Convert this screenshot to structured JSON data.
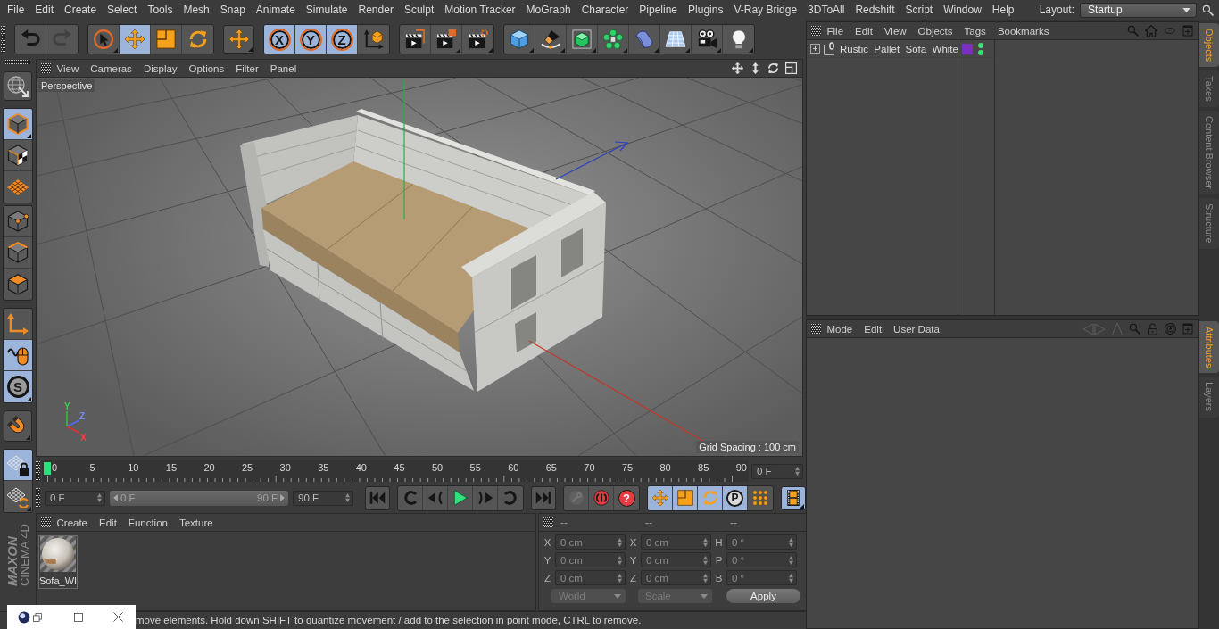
{
  "menu_bar": {
    "items": [
      "File",
      "Edit",
      "Create",
      "Select",
      "Tools",
      "Mesh",
      "Snap",
      "Animate",
      "Simulate",
      "Render",
      "Sculpt",
      "Motion Tracker",
      "MoGraph",
      "Character",
      "Pipeline",
      "Plugins",
      "V-Ray Bridge",
      "3DToAll",
      "Redshift",
      "Script",
      "Window",
      "Help"
    ],
    "layout_label": "Layout:",
    "layout_value": "Startup"
  },
  "toolbar": {
    "groups": [
      {
        "buttons": [
          {
            "on": false,
            "disabled": false
          },
          {
            "on": false,
            "disabled": true
          }
        ]
      },
      {
        "buttons": [
          {
            "on": false,
            "disabled": false
          },
          {
            "on": true,
            "disabled": false
          },
          {
            "on": false,
            "disabled": false
          },
          {
            "on": false,
            "disabled": false
          }
        ]
      },
      {
        "buttons": [
          {
            "on": false,
            "disabled": false
          }
        ]
      },
      {
        "buttons": [
          {
            "label": "X",
            "on": true,
            "disabled": false
          },
          {
            "label": "Y",
            "on": true,
            "disabled": false
          },
          {
            "label": "Z",
            "on": true,
            "disabled": false
          },
          {
            "on": false,
            "disabled": false
          }
        ]
      },
      {
        "buttons": [
          {
            "on": false,
            "disabled": false
          },
          {
            "on": false,
            "disabled": false
          },
          {
            "on": false,
            "disabled": false
          }
        ]
      },
      {
        "buttons": [
          {
            "on": false,
            "disabled": false
          },
          {
            "on": false,
            "disabled": false
          },
          {
            "on": false,
            "disabled": false
          },
          {
            "on": false,
            "disabled": false
          },
          {
            "on": false,
            "disabled": false
          },
          {
            "on": false,
            "disabled": false
          },
          {
            "on": false,
            "disabled": false
          },
          {
            "on": false,
            "disabled": false
          }
        ]
      }
    ]
  },
  "mode_toolbar": {
    "groups": [
      {
        "buttons": [
          {
            "on": false
          }
        ]
      },
      {
        "buttons": [
          {
            "on": true
          },
          {
            "on": false
          },
          {
            "on": false
          }
        ]
      },
      {
        "buttons": [
          {
            "on": false
          },
          {
            "on": false
          },
          {
            "on": false
          }
        ]
      },
      {
        "buttons": [
          {
            "on": false
          },
          {
            "on": true
          },
          {
            "label": "S",
            "on": true
          }
        ]
      },
      {
        "buttons": [
          {
            "on": false
          }
        ]
      },
      {
        "buttons": [
          {
            "on": true
          },
          {
            "on": false
          }
        ]
      }
    ]
  },
  "logo": {
    "brand": "MAXON",
    "product": "CINEMA 4D"
  },
  "viewport": {
    "menu": [
      "View",
      "Cameras",
      "Display",
      "Options",
      "Filter",
      "Panel"
    ],
    "camera": "Perspective",
    "grid_spacing": "Grid Spacing : 100 cm",
    "gizmo_labels": [
      "Y",
      "Z",
      "X"
    ]
  },
  "timeline": {
    "ticks": [
      "0",
      "5",
      "10",
      "15",
      "20",
      "25",
      "30",
      "35",
      "40",
      "45",
      "50",
      "55",
      "60",
      "65",
      "70",
      "75",
      "80",
      "85",
      "90"
    ],
    "playhead": {
      "level": 0
    },
    "current_frame": "0 F"
  },
  "transport": {
    "min_field": "0 F",
    "range_slider": {
      "start": "0 F",
      "end": "90 F",
      "level": 1
    },
    "max_field": "90 F",
    "groups": [
      {
        "buttons": [
          {
            "on": false
          }
        ]
      },
      {
        "buttons": [
          {
            "on": false
          },
          {
            "on": false
          },
          {
            "on": false
          },
          {
            "on": false
          },
          {
            "on": false
          }
        ]
      },
      {
        "buttons": [
          {
            "on": false
          }
        ]
      },
      {
        "buttons": [
          {
            "on": false,
            "disabled": true
          },
          {
            "on": false,
            "disabled": false
          },
          {
            "label": "?",
            "on": false,
            "disabled": false
          }
        ]
      },
      {
        "buttons": [
          {
            "on": true
          },
          {
            "on": true
          },
          {
            "on": true
          },
          {
            "label": "P",
            "on": true
          },
          {
            "on": false
          }
        ]
      },
      {
        "buttons": [
          {
            "on": true
          }
        ]
      }
    ]
  },
  "materials": {
    "menu": [
      "Create",
      "Edit",
      "Function",
      "Texture"
    ],
    "items": [
      {
        "name": "Sofa_WI",
        "selected": false
      }
    ]
  },
  "coordinates": {
    "headers": [
      "--",
      "--",
      "--"
    ],
    "rows": [
      {
        "cells": [
          {
            "label": "X",
            "value": "0 cm"
          },
          {
            "label": "X",
            "value": "0 cm"
          },
          {
            "label": "H",
            "value": "0 °"
          }
        ]
      },
      {
        "cells": [
          {
            "label": "Y",
            "value": "0 cm"
          },
          {
            "label": "Y",
            "value": "0 cm"
          },
          {
            "label": "P",
            "value": "0 °"
          }
        ]
      },
      {
        "cells": [
          {
            "label": "Z",
            "value": "0 cm"
          },
          {
            "label": "Z",
            "value": "0 cm"
          },
          {
            "label": "B",
            "value": "0 °"
          }
        ]
      }
    ],
    "dropdowns": [
      {
        "value": "World",
        "disabled": true
      },
      {
        "value": "Scale",
        "disabled": true
      }
    ],
    "apply": "Apply"
  },
  "status_bar": {
    "text": "move elements. Hold down SHIFT to quantize movement / add to the selection in point mode, CTRL to remove."
  },
  "objects_panel": {
    "menu": [
      "File",
      "Edit",
      "View",
      "Objects",
      "Tags",
      "Bookmarks"
    ],
    "objects": [
      {
        "name": "Rustic_Pallet_Sofa_White",
        "expanded": false,
        "selected": false,
        "color": "#7a2fc0",
        "editor_visible": true,
        "render_visible": true
      }
    ],
    "tabs": [
      {
        "label": "Objects",
        "selected": true
      },
      {
        "label": "Takes",
        "selected": false
      },
      {
        "label": "Content Browser",
        "selected": false
      },
      {
        "label": "Structure",
        "selected": false
      }
    ]
  },
  "attributes_panel": {
    "menu": [
      "Mode",
      "Edit",
      "User Data"
    ],
    "tabs": [
      {
        "label": "Attributes",
        "selected": true
      },
      {
        "label": "Layers",
        "selected": false
      }
    ]
  }
}
